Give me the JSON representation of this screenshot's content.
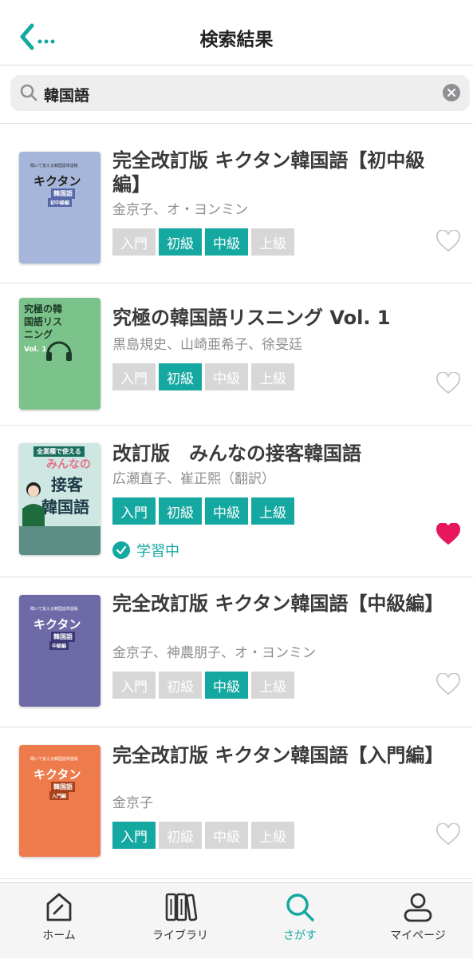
{
  "header": {
    "title": "検索結果",
    "back_label": "..."
  },
  "search": {
    "query": "韓国語"
  },
  "books": [
    {
      "title": "完全改訂版 キクタン韓国語【初中級編】",
      "author": "金京子、オ・ヨンミン",
      "cover_color": "#a5b6da",
      "tags": [
        {
          "label": "入門",
          "active": false
        },
        {
          "label": "初級",
          "active": true
        },
        {
          "label": "中級",
          "active": true
        },
        {
          "label": "上級",
          "active": false
        }
      ],
      "favorite": false
    },
    {
      "title": "究極の韓国語リスニング Vol. 1",
      "author": "黒島規史、山崎亜希子、徐旻廷",
      "cover_color": "#7cc38b",
      "tags": [
        {
          "label": "入門",
          "active": false
        },
        {
          "label": "初級",
          "active": true
        },
        {
          "label": "中級",
          "active": false
        },
        {
          "label": "上級",
          "active": false
        }
      ],
      "favorite": false
    },
    {
      "title": "改訂版　みんなの接客韓国語",
      "author": "広瀬直子、崔正熙（翻訳）",
      "cover_color": "#cfe7e3",
      "tags": [
        {
          "label": "入門",
          "active": true
        },
        {
          "label": "初級",
          "active": true
        },
        {
          "label": "中級",
          "active": true
        },
        {
          "label": "上級",
          "active": true
        }
      ],
      "favorite": true,
      "status": "学習中"
    },
    {
      "title": "完全改訂版 キクタン韓国語【中級編】",
      "author": "金京子、神農朋子、オ・ヨンミン",
      "cover_color": "#6e6aa8",
      "tags": [
        {
          "label": "入門",
          "active": false
        },
        {
          "label": "初級",
          "active": false
        },
        {
          "label": "中級",
          "active": true
        },
        {
          "label": "上級",
          "active": false
        }
      ],
      "favorite": false
    },
    {
      "title": "完全改訂版 キクタン韓国語【入門編】",
      "author": "金京子",
      "cover_color": "#ee7b4c",
      "tags": [
        {
          "label": "入門",
          "active": true
        },
        {
          "label": "初級",
          "active": false
        },
        {
          "label": "中級",
          "active": false
        },
        {
          "label": "上級",
          "active": false
        }
      ],
      "favorite": false
    }
  ],
  "covers": {
    "kikutan_title": "キクタン",
    "kikutan_sub": "韓国語",
    "kikutan_top": "聞いて覚える韓国語単語帳",
    "kikutan_badges": [
      "初中級編",
      "",
      "中級編",
      "入門編"
    ],
    "listening_title": "究極の韓国語リスニング",
    "listening_vol": "Vol. 1",
    "minna_banner": "全業種で使える",
    "minna_title": "みんなの",
    "minna_big1": "接客",
    "minna_big2": "韓国語"
  },
  "tabs": [
    {
      "label": "ホーム",
      "active": false
    },
    {
      "label": "ライブラリ",
      "active": false
    },
    {
      "label": "さがす",
      "active": true
    },
    {
      "label": "マイページ",
      "active": false
    }
  ],
  "colors": {
    "accent": "#14a8a0",
    "favorite": "#e6175c",
    "tag_off": "#d7d7d7"
  }
}
